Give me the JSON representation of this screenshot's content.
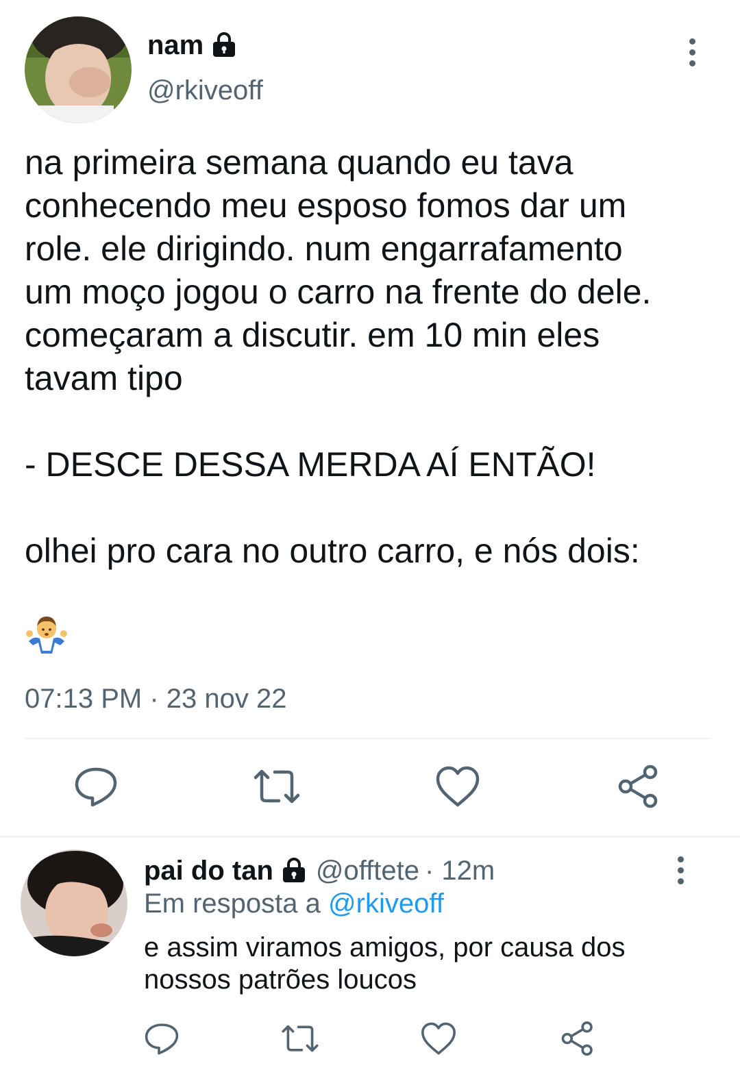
{
  "tweet": {
    "author": {
      "display_name": "nam",
      "handle": "@rkiveoff",
      "avatar": "avatar-photo-icon",
      "locked_icon": "lock-icon"
    },
    "text": "na primeira semana quando eu tava\nconhecendo meu esposo fomos dar um\nrole. ele dirigindo. num engarrafamento\num moço jogou o carro na frente do dele.\ncomeçaram a discutir. em 10 min eles\ntavam tipo\n\n- DESCE DESSA MERDA AÍ ENTÃO!\n\nolhei pro cara no outro carro, e nós dois:",
    "emoji": "🤷‍♂️",
    "timestamp": "07:13 PM · 23 nov 22",
    "actions": [
      "reply-icon",
      "retweet-icon",
      "like-icon",
      "share-icon"
    ]
  },
  "reply": {
    "author": {
      "display_name": "pai do tan",
      "handle": "@offtete",
      "time": "· 12m",
      "avatar": "avatar-photo-icon",
      "locked_icon": "lock-icon"
    },
    "reply_to_label": "Em resposta a",
    "reply_to_handle": "@rkiveoff",
    "text": "e assim viramos amigos, por causa dos nossos patrões loucos",
    "actions": [
      "reply-icon",
      "retweet-icon",
      "like-icon",
      "share-icon"
    ]
  },
  "colors": {
    "text": "#0f1419",
    "secondary": "#536471",
    "link": "#1d9bf0",
    "divider": "#eff3f4"
  }
}
